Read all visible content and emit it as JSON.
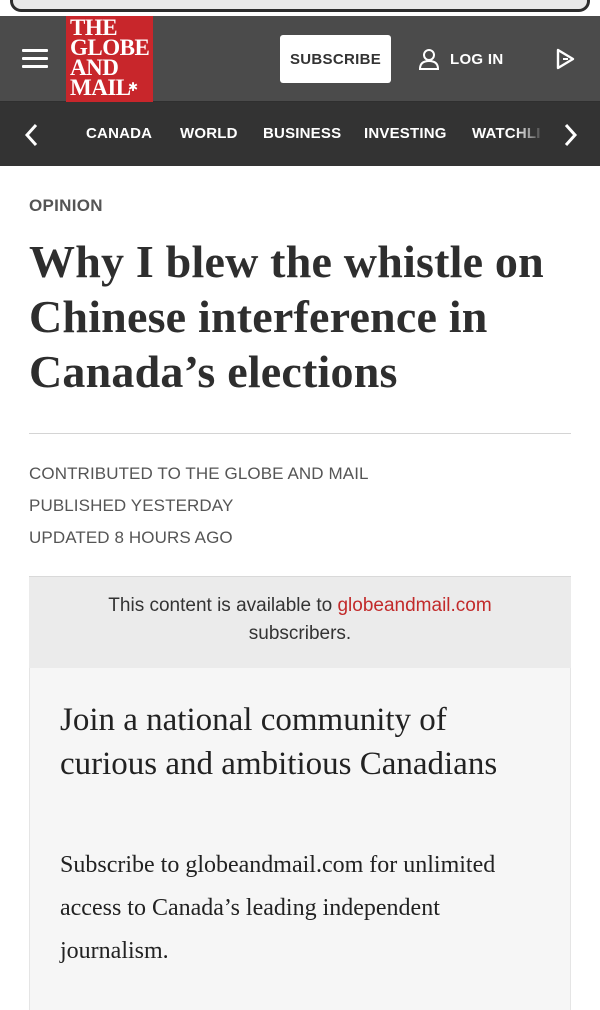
{
  "header": {
    "logo_lines": [
      "THE",
      "GLOBE",
      "AND",
      "MAIL"
    ],
    "subscribe_label": "SUBSCRIBE",
    "login_label": "LOG IN"
  },
  "nav": {
    "items": [
      "CANADA",
      "WORLD",
      "BUSINESS",
      "INVESTING",
      "WATCHLIST"
    ]
  },
  "article": {
    "section": "OPINION",
    "headline": "Why I blew the whistle on Chinese interference in Canada’s elections",
    "byline": "CONTRIBUTED TO THE GLOBE AND MAIL",
    "published": "PUBLISHED YESTERDAY",
    "updated": "UPDATED 8 HOURS AGO"
  },
  "paywall": {
    "notice_prefix": "This content is available to ",
    "notice_link": "globeandmail.com",
    "notice_suffix": "subscribers.",
    "heading": "Join a national community of curious and ambitious Canadians",
    "body": "Subscribe to globeandmail.com for unlimited access to Canada’s leading independent journalism."
  },
  "colors": {
    "brand_red": "#c8262b",
    "header_bg": "#4b4b4b",
    "nav_bg": "#333333",
    "link_red": "#c22a2a"
  },
  "icons": [
    "menu-icon",
    "user-icon",
    "play-icon",
    "chevron-left-icon",
    "chevron-right-icon",
    "maple-leaf-icon"
  ]
}
